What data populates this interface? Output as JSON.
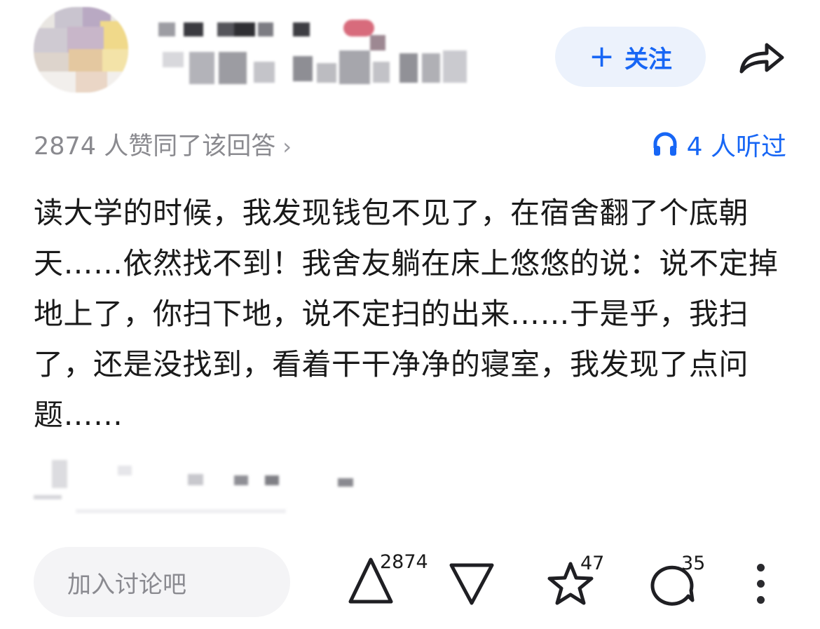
{
  "header": {
    "follow_plus": "+",
    "follow_label": "关注",
    "share_icon": "share-arrow-icon"
  },
  "meta": {
    "likes_summary": "2874 人赞同了该回答",
    "chevron": "›",
    "listen_label": "4 人听过",
    "listen_icon": "headphones-icon"
  },
  "answer": {
    "text": "读大学的时候，我发现钱包不见了，在宿舍翻了个底朝天……依然找不到！我舍友躺在床上悠悠的说：说不定掉地上了，你扫下地，说不定扫的出来……于是乎，我扫了，还是没找到，看着干干净净的寝室，我发现了点问题……"
  },
  "bottom_bar": {
    "comment_placeholder": "加入讨论吧",
    "upvote_count": "2874",
    "favorite_count": "47",
    "comment_count": "35"
  },
  "colors": {
    "accent": "#1766f5",
    "follow_bg": "#ecf2fc",
    "muted_text": "#8a8a8f",
    "input_bg": "#f4f4f6"
  }
}
